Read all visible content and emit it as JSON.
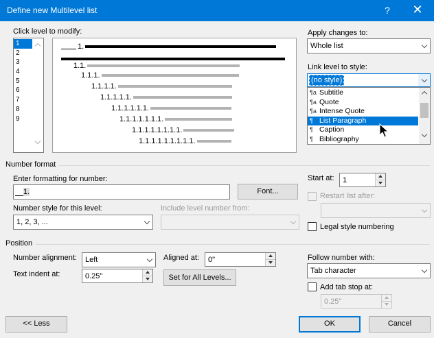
{
  "window": {
    "title": "Define new Multilevel list",
    "help_glyph": "?",
    "close_glyph": "✕"
  },
  "click_level": {
    "label": "Click level to modify:",
    "levels": [
      "1",
      "2",
      "3",
      "4",
      "5",
      "6",
      "7",
      "8",
      "9"
    ],
    "selected": "1"
  },
  "preview": {
    "numbers": [
      "1.",
      "1.1.",
      "1.1.1.",
      "1.1.1.1.",
      "1.1.1.1.1.",
      "1.1.1.1.1.1.",
      "1.1.1.1.1.1.1.",
      "1.1.1.1.1.1.1.1.",
      "1.1.1.1.1.1.1.1.1."
    ]
  },
  "apply_changes": {
    "label": "Apply changes to:",
    "value": "Whole list"
  },
  "link_level": {
    "label": "Link level to style:",
    "value": "(no style)",
    "options": [
      {
        "icon": "paragraph-char-style-icon",
        "glyph": "¶a",
        "label": "Subtitle"
      },
      {
        "icon": "paragraph-char-style-icon",
        "glyph": "¶a",
        "label": "Quote"
      },
      {
        "icon": "paragraph-char-style-icon",
        "glyph": "¶a",
        "label": "Intense Quote"
      },
      {
        "icon": "paragraph-style-icon",
        "glyph": "¶",
        "label": "List Paragraph"
      },
      {
        "icon": "paragraph-style-icon",
        "glyph": "¶",
        "label": "Caption"
      },
      {
        "icon": "paragraph-style-icon",
        "glyph": "¶",
        "label": "Bibliography"
      }
    ],
    "selected": "List Paragraph"
  },
  "number_format": {
    "section_label": "Number format",
    "enter_label": "Enter formatting for number:",
    "format_value": "1.",
    "font_button": "Font...",
    "style_label": "Number style for this level:",
    "style_value": "1, 2, 3, ...",
    "include_label": "Include level number from:",
    "include_value": "",
    "start_label": "Start at:",
    "start_value": "1",
    "restart_label": "Restart list after:",
    "restart_value": "",
    "legal_label": "Legal style numbering",
    "legal_checked": false,
    "restart_checked": false
  },
  "position": {
    "section_label": "Position",
    "alignment_label": "Number alignment:",
    "alignment_value": "Left",
    "aligned_at_label": "Aligned at:",
    "aligned_at_value": "0\"",
    "indent_label": "Text indent at:",
    "indent_value": "0.25\"",
    "set_all_button": "Set for All Levels...",
    "follow_label": "Follow number with:",
    "follow_value": "Tab character",
    "tab_stop_label": "Add tab stop at:",
    "tab_stop_value": "0.25\"",
    "tab_stop_checked": false
  },
  "footer": {
    "less_button": "<< Less",
    "ok_button": "OK",
    "cancel_button": "Cancel"
  }
}
